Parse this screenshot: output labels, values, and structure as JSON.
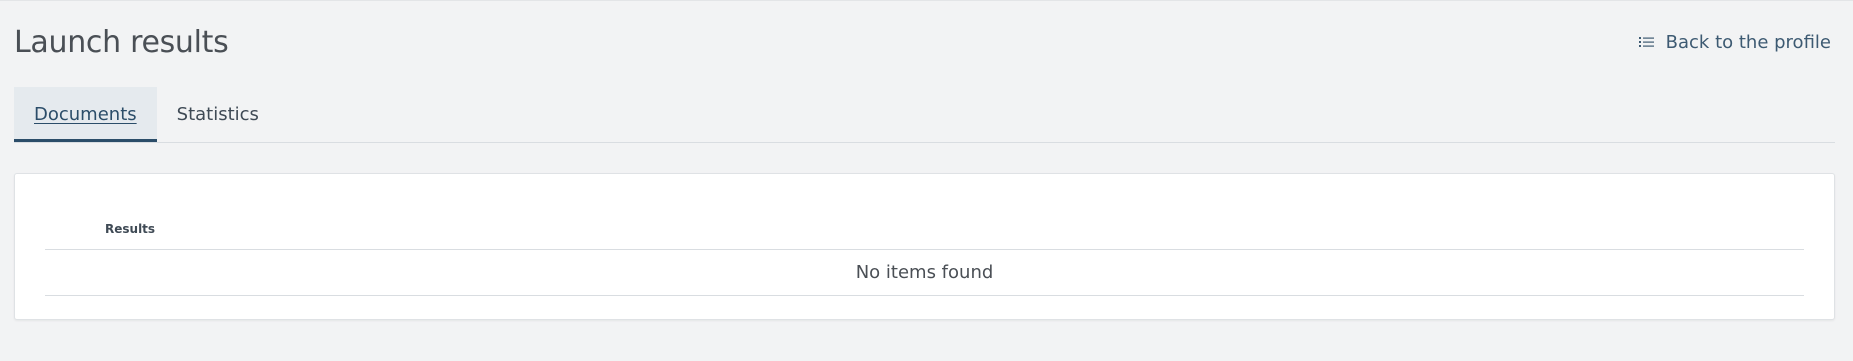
{
  "header": {
    "title": "Launch results",
    "back_link": {
      "label": "Back to the profile",
      "icon": "list-icon"
    }
  },
  "tabs": [
    {
      "label": "Documents",
      "active": true
    },
    {
      "label": "Statistics",
      "active": false
    }
  ],
  "table": {
    "columns": [
      "Results"
    ],
    "empty_message": "No items found"
  },
  "colors": {
    "background": "#f2f3f4",
    "accent": "#2b4d69",
    "card": "#ffffff"
  }
}
